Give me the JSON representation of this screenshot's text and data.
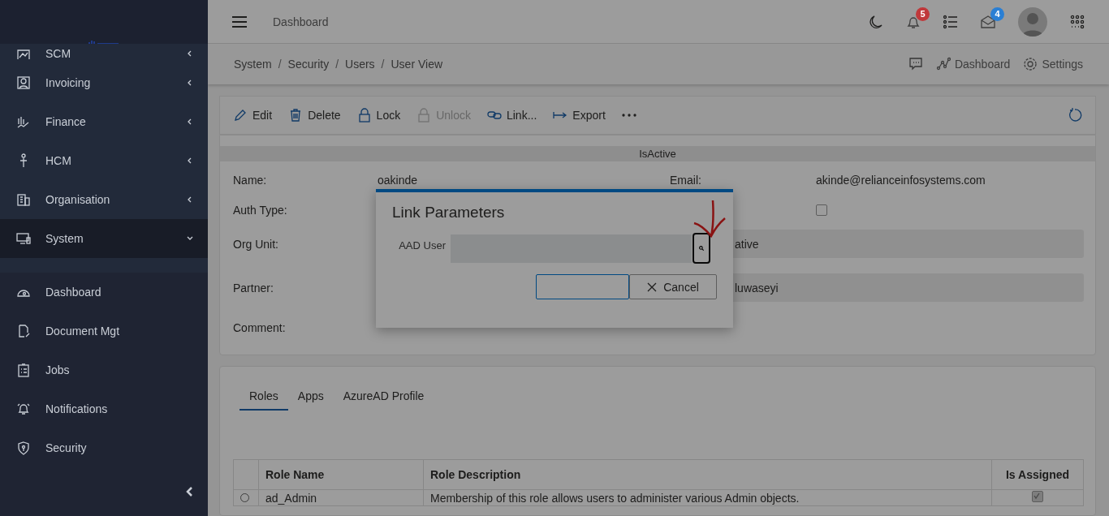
{
  "sidebar": {
    "items": [
      {
        "label": "SCM",
        "has_submenu": true,
        "expanded": false,
        "selected": false
      },
      {
        "label": "Invoicing",
        "has_submenu": true,
        "expanded": false,
        "selected": false
      },
      {
        "label": "Finance",
        "has_submenu": true,
        "expanded": false,
        "selected": false
      },
      {
        "label": "HCM",
        "has_submenu": true,
        "expanded": false,
        "selected": false
      },
      {
        "label": "Organisation",
        "has_submenu": true,
        "expanded": false,
        "selected": false
      },
      {
        "label": "System",
        "has_submenu": true,
        "expanded": true,
        "selected": true
      },
      {
        "label": "Dashboard",
        "has_submenu": false,
        "selected": false
      },
      {
        "label": "Document Mgt",
        "has_submenu": false,
        "selected": false
      },
      {
        "label": "Jobs",
        "has_submenu": false,
        "selected": false
      },
      {
        "label": "Notifications",
        "has_submenu": false,
        "selected": false
      },
      {
        "label": "Security",
        "has_submenu": false,
        "selected": false
      }
    ]
  },
  "topbar": {
    "title": "Dashboard",
    "badges": [
      {
        "kind": "notifications",
        "count": "5",
        "color": "#c0393b"
      },
      {
        "kind": "messages",
        "count": "4",
        "color": "#2a7fd4"
      }
    ]
  },
  "breadcrumb": {
    "items": [
      "System",
      "/",
      "Security",
      "/",
      "Users",
      "/",
      "User View"
    ],
    "links": [
      "Dashboard",
      "Settings"
    ]
  },
  "toolbar": {
    "actions": [
      {
        "label": "Edit",
        "disabled": false
      },
      {
        "label": "Delete",
        "disabled": false
      },
      {
        "label": "Lock",
        "disabled": false
      },
      {
        "label": "Unlock",
        "disabled": true
      },
      {
        "label": "Link...",
        "disabled": false
      },
      {
        "label": "Export",
        "disabled": false
      }
    ]
  },
  "form": {
    "section_title": "IsActive",
    "left": [
      {
        "label": "Name:",
        "value": "oakinde"
      },
      {
        "label": "Auth Type:"
      },
      {
        "label": "Org Unit:"
      },
      {
        "label": "Partner:"
      },
      {
        "label": "Comment:"
      }
    ],
    "right": [
      {
        "kind": "text",
        "label": "Email:",
        "value": "akinde@relianceinfosystems.com"
      },
      {
        "kind": "checkbox",
        "checked": false
      },
      {
        "kind": "field",
        "value": "ative"
      },
      {
        "kind": "field",
        "value": "luwaseyi"
      }
    ]
  },
  "tabs": [
    {
      "label": "Roles",
      "selected": true
    },
    {
      "label": "Apps",
      "selected": false
    },
    {
      "label": "AzureAD Profile",
      "selected": false
    }
  ],
  "table": {
    "columns": [
      "Role Name",
      "Role Description",
      "Is Assigned"
    ],
    "rows": [
      {
        "selected": false,
        "role_name": "ad_Admin",
        "description": "Membership of this role allows users to administer various Admin objects.",
        "assigned": true
      }
    ]
  },
  "dialog": {
    "title": "Link Parameters",
    "field_label": "AAD User",
    "cancel": "Cancel"
  }
}
